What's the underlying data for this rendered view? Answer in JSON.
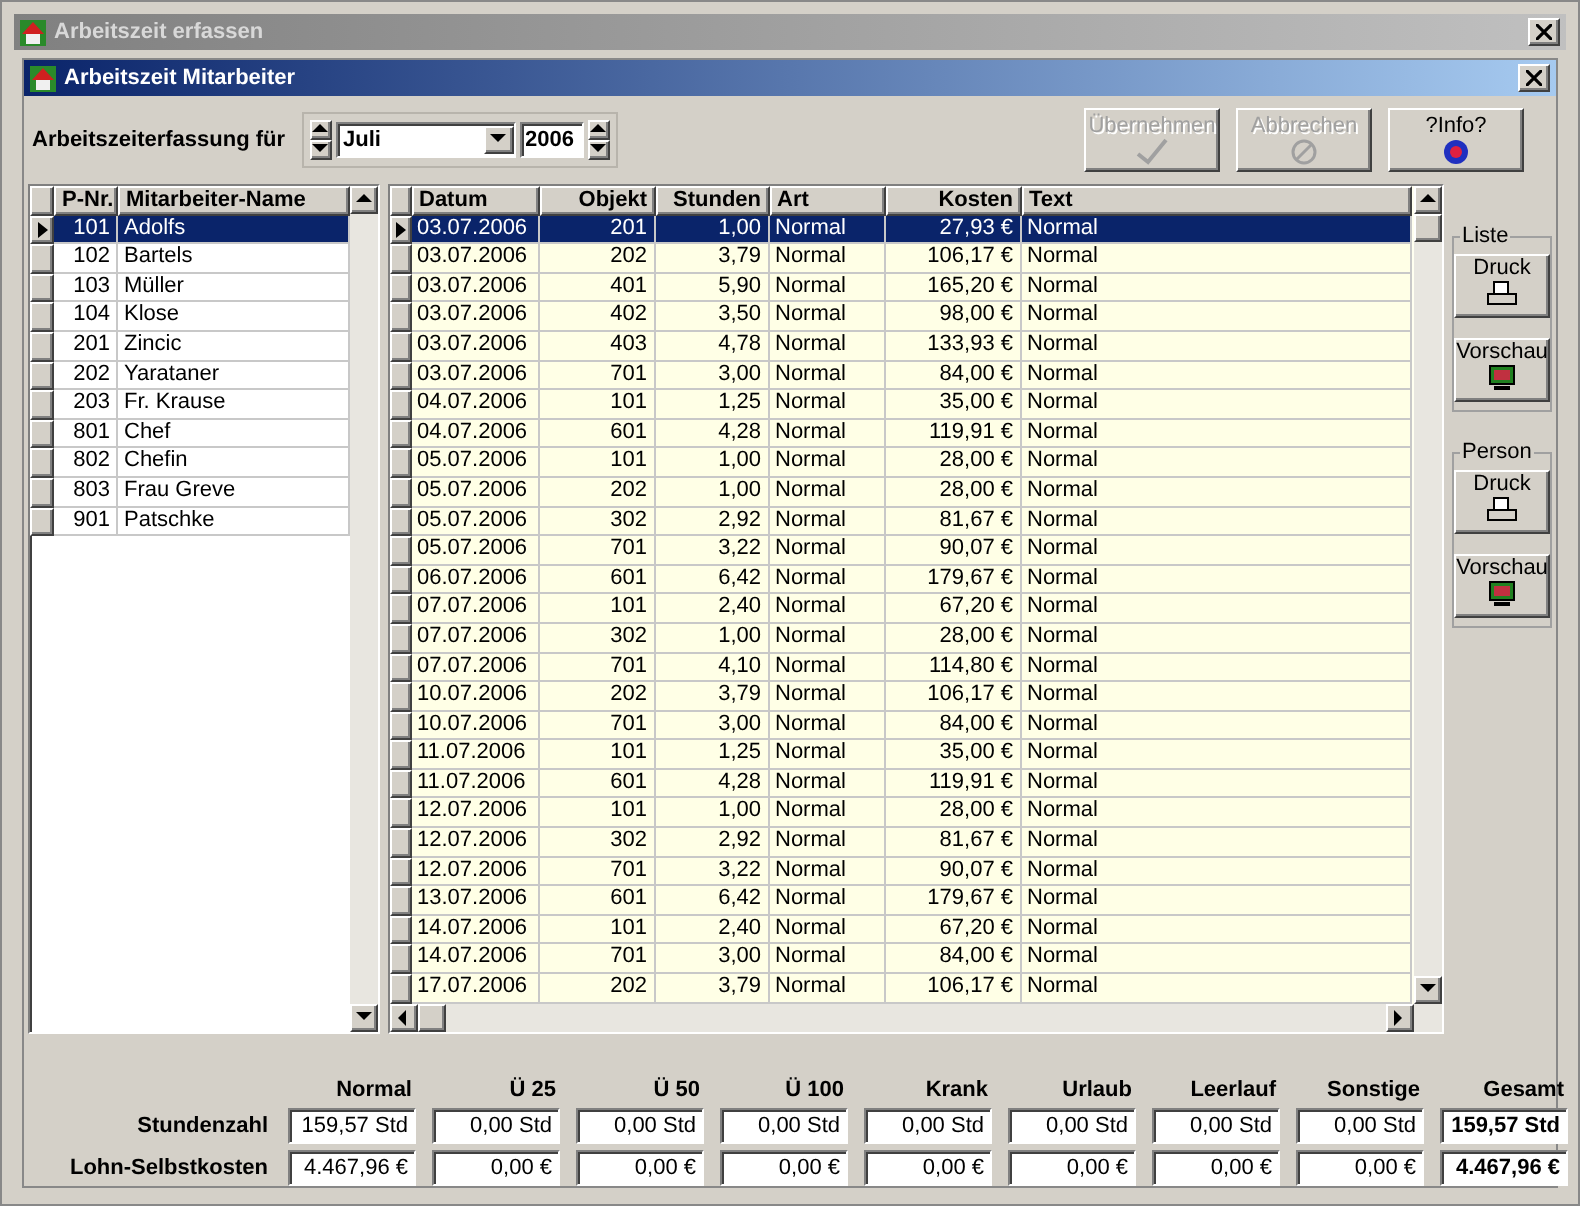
{
  "outer_window": {
    "title": "Arbeitszeit erfassen"
  },
  "inner_window": {
    "title": "Arbeitszeit Mitarbeiter"
  },
  "period": {
    "label": "Arbeitszeiterfassung für",
    "month": "Juli",
    "year": "2006"
  },
  "buttons": [
    {
      "label": "Übernehmen",
      "kind": "check",
      "disabled": true
    },
    {
      "label": "Abbrechen",
      "kind": "cancel",
      "disabled": true
    },
    {
      "label": "?Info?",
      "kind": "info",
      "disabled": false
    }
  ],
  "employees": {
    "columns": [
      "P-Nr.",
      "Mitarbeiter-Name"
    ],
    "rows": [
      {
        "nr": "101",
        "name": "Adolfs",
        "selected": true
      },
      {
        "nr": "102",
        "name": "Bartels",
        "selected": false
      },
      {
        "nr": "103",
        "name": "Müller",
        "selected": false
      },
      {
        "nr": "104",
        "name": "Klose",
        "selected": false
      },
      {
        "nr": "201",
        "name": "Zincic",
        "selected": false
      },
      {
        "nr": "202",
        "name": "Yarataner",
        "selected": false
      },
      {
        "nr": "203",
        "name": "Fr. Krause",
        "selected": false
      },
      {
        "nr": "801",
        "name": "Chef",
        "selected": false
      },
      {
        "nr": "802",
        "name": "Chefin",
        "selected": false
      },
      {
        "nr": "803",
        "name": "Frau Greve",
        "selected": false
      },
      {
        "nr": "901",
        "name": "Patschke",
        "selected": false
      }
    ]
  },
  "entries": {
    "columns": [
      "Datum",
      "Objekt",
      "Stunden",
      "Art",
      "Kosten",
      "Text"
    ],
    "rows": [
      {
        "datum": "03.07.2006",
        "objekt": "201",
        "stunden": "1,00",
        "art": "Normal",
        "kosten": "27,93 €",
        "text": "Normal",
        "selected": true
      },
      {
        "datum": "03.07.2006",
        "objekt": "202",
        "stunden": "3,79",
        "art": "Normal",
        "kosten": "106,17 €",
        "text": "Normal",
        "selected": false
      },
      {
        "datum": "03.07.2006",
        "objekt": "401",
        "stunden": "5,90",
        "art": "Normal",
        "kosten": "165,20 €",
        "text": "Normal",
        "selected": false
      },
      {
        "datum": "03.07.2006",
        "objekt": "402",
        "stunden": "3,50",
        "art": "Normal",
        "kosten": "98,00 €",
        "text": "Normal",
        "selected": false
      },
      {
        "datum": "03.07.2006",
        "objekt": "403",
        "stunden": "4,78",
        "art": "Normal",
        "kosten": "133,93 €",
        "text": "Normal",
        "selected": false
      },
      {
        "datum": "03.07.2006",
        "objekt": "701",
        "stunden": "3,00",
        "art": "Normal",
        "kosten": "84,00 €",
        "text": "Normal",
        "selected": false
      },
      {
        "datum": "04.07.2006",
        "objekt": "101",
        "stunden": "1,25",
        "art": "Normal",
        "kosten": "35,00 €",
        "text": "Normal",
        "selected": false
      },
      {
        "datum": "04.07.2006",
        "objekt": "601",
        "stunden": "4,28",
        "art": "Normal",
        "kosten": "119,91 €",
        "text": "Normal",
        "selected": false
      },
      {
        "datum": "05.07.2006",
        "objekt": "101",
        "stunden": "1,00",
        "art": "Normal",
        "kosten": "28,00 €",
        "text": "Normal",
        "selected": false
      },
      {
        "datum": "05.07.2006",
        "objekt": "202",
        "stunden": "1,00",
        "art": "Normal",
        "kosten": "28,00 €",
        "text": "Normal",
        "selected": false
      },
      {
        "datum": "05.07.2006",
        "objekt": "302",
        "stunden": "2,92",
        "art": "Normal",
        "kosten": "81,67 €",
        "text": "Normal",
        "selected": false
      },
      {
        "datum": "05.07.2006",
        "objekt": "701",
        "stunden": "3,22",
        "art": "Normal",
        "kosten": "90,07 €",
        "text": "Normal",
        "selected": false
      },
      {
        "datum": "06.07.2006",
        "objekt": "601",
        "stunden": "6,42",
        "art": "Normal",
        "kosten": "179,67 €",
        "text": "Normal",
        "selected": false
      },
      {
        "datum": "07.07.2006",
        "objekt": "101",
        "stunden": "2,40",
        "art": "Normal",
        "kosten": "67,20 €",
        "text": "Normal",
        "selected": false
      },
      {
        "datum": "07.07.2006",
        "objekt": "302",
        "stunden": "1,00",
        "art": "Normal",
        "kosten": "28,00 €",
        "text": "Normal",
        "selected": false
      },
      {
        "datum": "07.07.2006",
        "objekt": "701",
        "stunden": "4,10",
        "art": "Normal",
        "kosten": "114,80 €",
        "text": "Normal",
        "selected": false
      },
      {
        "datum": "10.07.2006",
        "objekt": "202",
        "stunden": "3,79",
        "art": "Normal",
        "kosten": "106,17 €",
        "text": "Normal",
        "selected": false
      },
      {
        "datum": "10.07.2006",
        "objekt": "701",
        "stunden": "3,00",
        "art": "Normal",
        "kosten": "84,00 €",
        "text": "Normal",
        "selected": false
      },
      {
        "datum": "11.07.2006",
        "objekt": "101",
        "stunden": "1,25",
        "art": "Normal",
        "kosten": "35,00 €",
        "text": "Normal",
        "selected": false
      },
      {
        "datum": "11.07.2006",
        "objekt": "601",
        "stunden": "4,28",
        "art": "Normal",
        "kosten": "119,91 €",
        "text": "Normal",
        "selected": false
      },
      {
        "datum": "12.07.2006",
        "objekt": "101",
        "stunden": "1,00",
        "art": "Normal",
        "kosten": "28,00 €",
        "text": "Normal",
        "selected": false
      },
      {
        "datum": "12.07.2006",
        "objekt": "302",
        "stunden": "2,92",
        "art": "Normal",
        "kosten": "81,67 €",
        "text": "Normal",
        "selected": false
      },
      {
        "datum": "12.07.2006",
        "objekt": "701",
        "stunden": "3,22",
        "art": "Normal",
        "kosten": "90,07 €",
        "text": "Normal",
        "selected": false
      },
      {
        "datum": "13.07.2006",
        "objekt": "601",
        "stunden": "6,42",
        "art": "Normal",
        "kosten": "179,67 €",
        "text": "Normal",
        "selected": false
      },
      {
        "datum": "14.07.2006",
        "objekt": "101",
        "stunden": "2,40",
        "art": "Normal",
        "kosten": "67,20 €",
        "text": "Normal",
        "selected": false
      },
      {
        "datum": "14.07.2006",
        "objekt": "701",
        "stunden": "3,00",
        "art": "Normal",
        "kosten": "84,00 €",
        "text": "Normal",
        "selected": false
      },
      {
        "datum": "17.07.2006",
        "objekt": "202",
        "stunden": "3,79",
        "art": "Normal",
        "kosten": "106,17 €",
        "text": "Normal",
        "selected": false
      }
    ]
  },
  "side_groups": [
    {
      "title": "Liste",
      "buttons": [
        {
          "label": "Druck",
          "kind": "print"
        },
        {
          "label": "Vorschau",
          "kind": "preview"
        }
      ]
    },
    {
      "title": "Person",
      "buttons": [
        {
          "label": "Druck",
          "kind": "print"
        },
        {
          "label": "Vorschau",
          "kind": "preview"
        }
      ]
    }
  ],
  "totals": {
    "columns": [
      "Normal",
      "Ü 25",
      "Ü 50",
      "Ü 100",
      "Krank",
      "Urlaub",
      "Leerlauf",
      "Sonstige",
      "Gesamt"
    ],
    "rows": [
      {
        "label": "Stundenzahl",
        "values": [
          "159,57 Std",
          "0,00 Std",
          "0,00 Std",
          "0,00 Std",
          "0,00 Std",
          "0,00 Std",
          "0,00 Std",
          "0,00 Std",
          "159,57 Std"
        ]
      },
      {
        "label": "Lohn-Selbstkosten",
        "values": [
          "4.467,96 €",
          "0,00 €",
          "0,00 €",
          "0,00 €",
          "0,00 €",
          "0,00 €",
          "0,00 €",
          "0,00 €",
          "4.467,96 €"
        ]
      }
    ]
  }
}
